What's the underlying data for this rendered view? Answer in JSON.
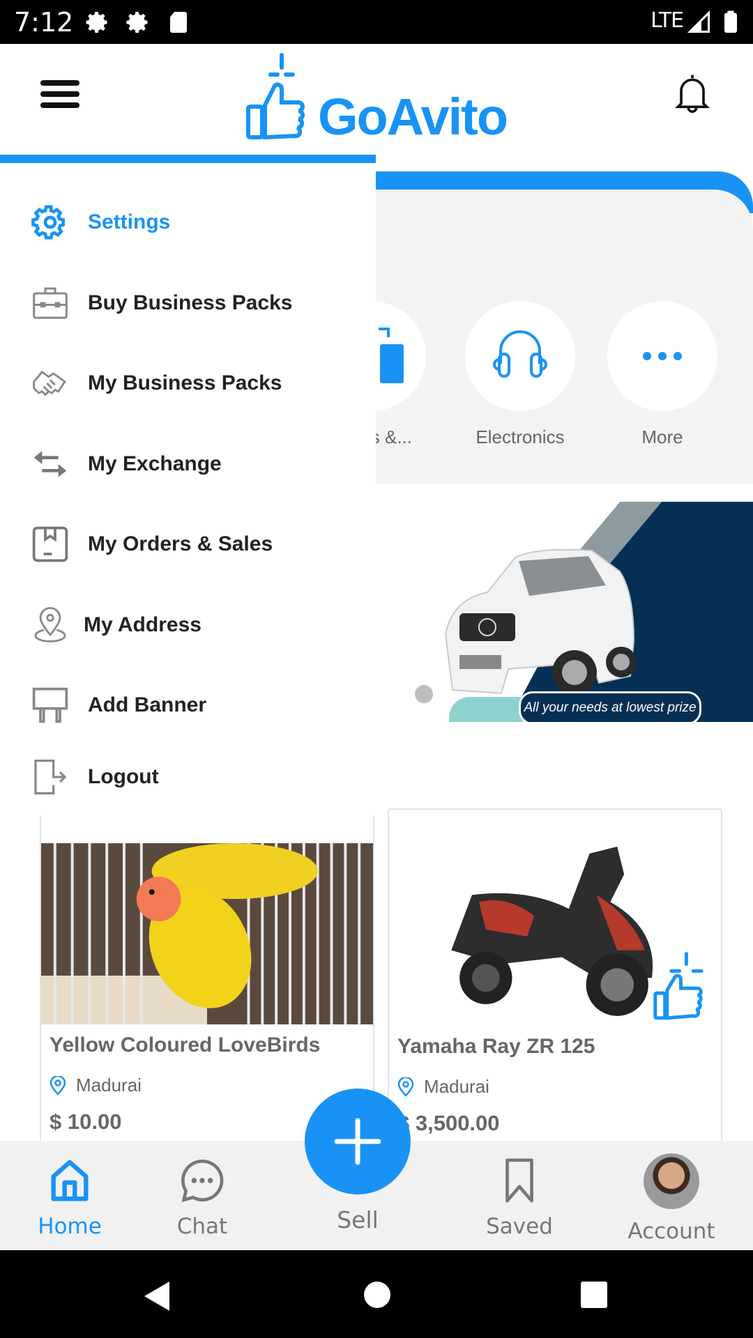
{
  "status_bar": {
    "time": "7:12",
    "left_icons": [
      "gear-icon",
      "gear-icon",
      "sd-card-icon"
    ],
    "network": "LTE",
    "right_icons": [
      "signal-icon",
      "battery-icon"
    ]
  },
  "header": {
    "menu_icon": "hamburger-icon",
    "logo_text": "GoAvito",
    "notification_icon": "bell-icon"
  },
  "drawer": {
    "items": [
      {
        "label": "Settings",
        "icon": "gear-icon",
        "active": true
      },
      {
        "label": "Buy Business Packs",
        "icon": "briefcase-icon",
        "active": false
      },
      {
        "label": "My Business Packs",
        "icon": "handshake-icon",
        "active": false
      },
      {
        "label": "My Exchange",
        "icon": "exchange-arrows-icon",
        "active": false
      },
      {
        "label": "My Orders & Sales",
        "icon": "package-icon",
        "active": false
      },
      {
        "label": "My Address",
        "icon": "map-pin-icon",
        "active": false
      },
      {
        "label": "Add Banner",
        "icon": "banner-stand-icon",
        "active": false
      },
      {
        "label": "Logout",
        "icon": "logout-icon",
        "active": false
      }
    ]
  },
  "categories": [
    {
      "label": "es &...",
      "icon": "phone-icon"
    },
    {
      "label": "Electronics",
      "icon": "headphones-icon"
    },
    {
      "label": "More",
      "icon": "more-dots-icon"
    }
  ],
  "banner": {
    "tagline": "All your needs at lowest prize",
    "page_count": 1,
    "active_page": 1
  },
  "products": [
    {
      "title": "Yellow Coloured LoveBirds",
      "location": "Madurai",
      "price": "$ 10.00"
    },
    {
      "title": "Yamaha Ray ZR 125",
      "location": "Madurai",
      "price": "$ 3,500.00"
    }
  ],
  "bottom_nav": {
    "items": [
      {
        "label": "Home",
        "icon": "home-icon",
        "active": true
      },
      {
        "label": "Chat",
        "icon": "chat-icon",
        "active": false
      },
      {
        "label": "Sell",
        "icon": "plus-icon",
        "active": false
      },
      {
        "label": "Saved",
        "icon": "bookmark-icon",
        "active": false
      },
      {
        "label": "Account",
        "icon": "avatar",
        "active": false
      }
    ]
  },
  "colors": {
    "accent": "#1893f5",
    "text_dark": "#222222",
    "text_muted": "#666666",
    "nav_bg": "#f1f1f1",
    "banner_navy": "#062f55"
  }
}
